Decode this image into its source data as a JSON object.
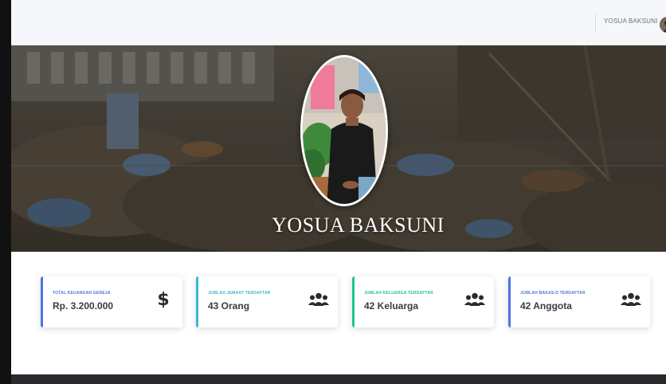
{
  "topbar": {
    "user_name": "YOSUA BAKSUNI"
  },
  "profile": {
    "name": "YOSUA BAKSUNI"
  },
  "stats": [
    {
      "label": "TOTAL KEUANGAN GEREJA",
      "value": "Rp. 3.200.000",
      "icon": "dollar-icon",
      "accent": "#4e73df"
    },
    {
      "label": "JUMLAH JEMAAT TERDAFTAR",
      "value": "43 Orang",
      "icon": "users-icon",
      "accent": "#36b9cc"
    },
    {
      "label": "JUMLAH KELUARGA TERDAFTAR",
      "value": "42 Keluarga",
      "icon": "users-icon",
      "accent": "#1cc88a"
    },
    {
      "label": "JUMLAH BAKAS-D TERDAFTAR",
      "value": "42 Anggota",
      "icon": "users-icon",
      "accent": "#4e73df"
    }
  ],
  "colors": {
    "sidebar": "#111111",
    "topbar": "#f5f7fa",
    "footer": "#2a2a2e"
  }
}
